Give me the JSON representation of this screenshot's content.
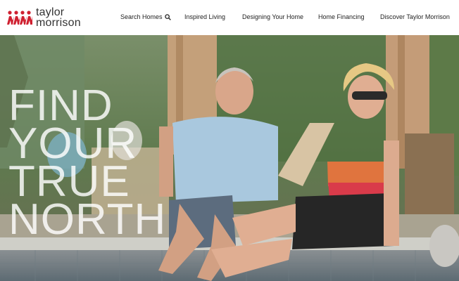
{
  "brand": {
    "name_line1": "taylor",
    "name_line2": "morrison",
    "logo_color": "#cf2030"
  },
  "nav": {
    "items": [
      {
        "label": "Search Homes",
        "icon": "search-icon"
      },
      {
        "label": "Inspired Living"
      },
      {
        "label": "Designing Your Home"
      },
      {
        "label": "Home Financing"
      },
      {
        "label": "Discover Taylor Morrison"
      }
    ]
  },
  "hero": {
    "headline_lines": [
      "FIND",
      "YOUR",
      "TRUE",
      "NORTH"
    ],
    "photo": "couple-relaxing-by-pool"
  },
  "colors": {
    "accent": "#cf2030",
    "text": "#222222",
    "headline": "#ffffff"
  }
}
